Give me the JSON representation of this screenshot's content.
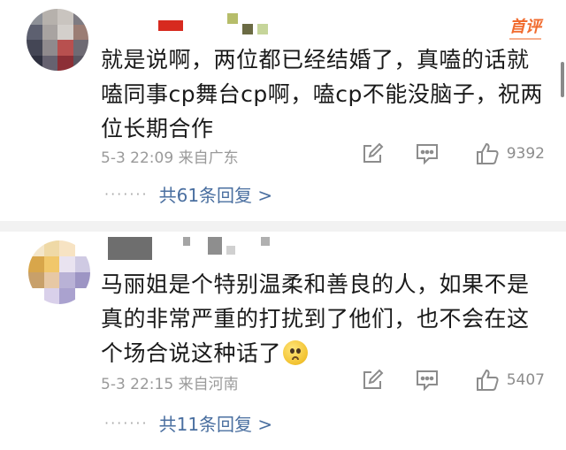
{
  "comments": [
    {
      "text": "就是说啊，两位都已经结婚了，真嗑的话就嗑同事cp舞台cp啊，嗑cp不能没脑子，祝两位长期合作",
      "meta": "5-3 22:09 来自广东",
      "badge": "首评",
      "like_count": "9392",
      "replies_label": "共61条回复 >"
    },
    {
      "text": "马丽姐是个特别温柔和善良的人，如果不是真的非常严重的打扰到了他们，也不会在这个场合说这种话了",
      "meta": "5-3 22:15 来自河南",
      "like_count": "5407",
      "replies_label": "共11条回复 >"
    }
  ],
  "icons": {
    "repost": "edit-square-icon",
    "comment": "comment-bubble-icon",
    "like": "thumbs-up-icon",
    "emoji": "pleading-face-emoji"
  },
  "colors": {
    "link": "#4a6fa0",
    "badge": "#f16b2e",
    "meta": "#9a9a9a"
  }
}
